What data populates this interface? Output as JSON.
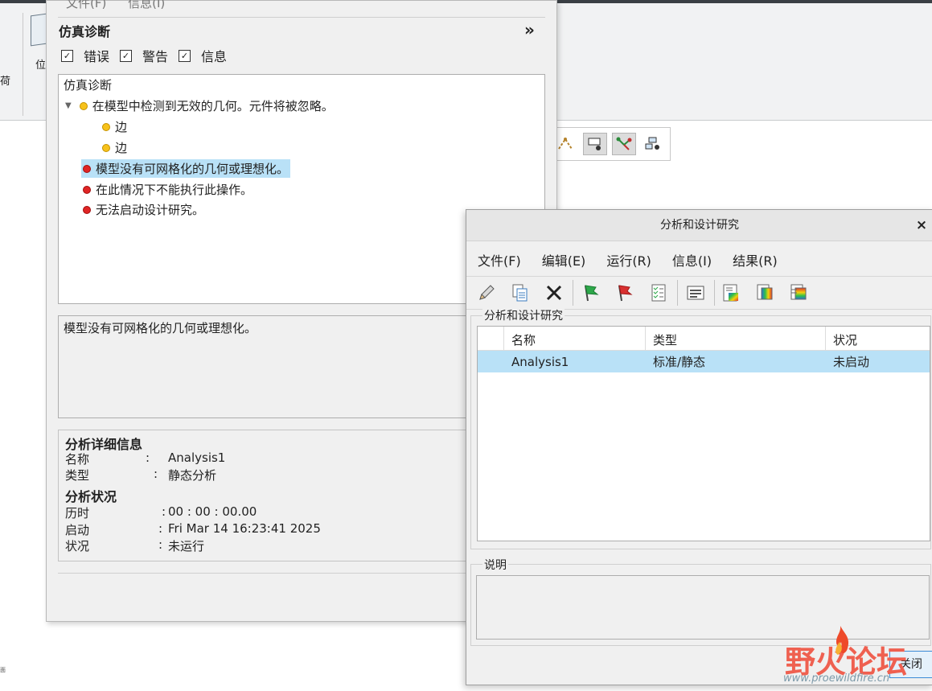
{
  "background_app": {
    "ribbon_load_label": "荷",
    "ribbon_position_label": "位",
    "tiny_text": "面"
  },
  "sim_diag": {
    "menu": [
      "文件(F)",
      "信息(I)"
    ],
    "title": "仿真诊断",
    "collapse_glyph": "»",
    "filters": [
      {
        "label": "错误",
        "checked": true
      },
      {
        "label": "警告",
        "checked": true
      },
      {
        "label": "信息",
        "checked": true
      }
    ],
    "tree": {
      "root": "仿真诊断",
      "warning_group": "在模型中检测到无效的几何。元件将被忽略。",
      "warning_children": [
        "边",
        "边"
      ],
      "errors": [
        "模型没有可网格化的几何或理想化。",
        "在此情况下不能执行此操作。",
        "无法启动设计研究。"
      ]
    },
    "message": "模型没有可网格化的几何或理想化。",
    "details": {
      "header": "分析详细信息",
      "name_label": "名称",
      "name_value": "Analysis1",
      "type_label": "类型",
      "type_value": "静态分析",
      "status_header": "分析状况",
      "elapsed_label": "历时",
      "elapsed_value": "00 : 00 : 00.00",
      "start_label": "启动",
      "start_value": "Fri Mar 14 16:23:41 2025",
      "state_label": "状况",
      "state_value": "未运行",
      "colon": ":"
    }
  },
  "studies_dialog": {
    "title": "分析和设计研究",
    "close_glyph": "×",
    "menu": [
      "文件(F)",
      "编辑(E)",
      "运行(R)",
      "信息(I)",
      "结果(R)"
    ],
    "toolbar_icons": [
      "pencil-icon",
      "copy-icon",
      "delete-icon",
      "green-flag-icon",
      "red-flag-icon",
      "status-list-icon",
      "review-icon",
      "results-icon",
      "results-copy-icon",
      "results-insert-icon"
    ],
    "group_title": "分析和设计研究",
    "columns": [
      "名称",
      "类型",
      "状况"
    ],
    "rows": [
      {
        "name": "Analysis1",
        "type": "标准/静态",
        "status": "未启动"
      }
    ],
    "description_title": "说明",
    "close_button": "关闭"
  },
  "watermark": {
    "text": "野火论坛",
    "url": "www.proewildfire.cn"
  },
  "colors": {
    "selection": "#b9e1f7",
    "error": "#e02525",
    "warning": "#f7c21b"
  }
}
